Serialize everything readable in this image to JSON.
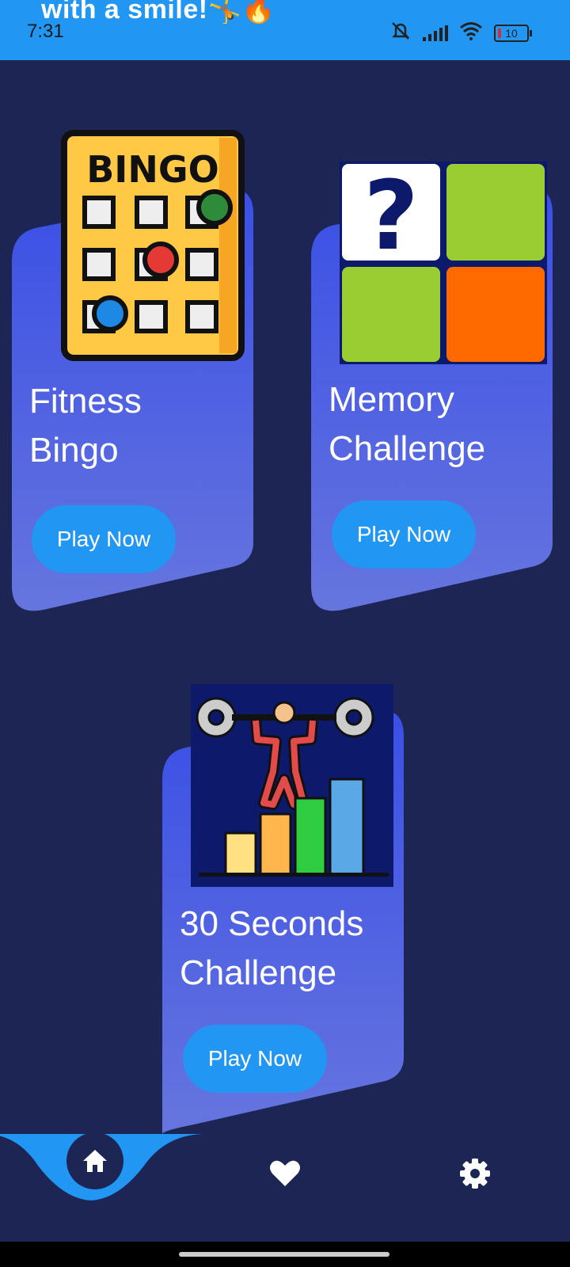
{
  "status_bar": {
    "banner_text": "with a smile!🤸🔥",
    "time": "7:31",
    "battery_level": "10",
    "icons": [
      "mute-icon",
      "signal-icon",
      "wifi-icon",
      "battery-icon"
    ]
  },
  "cards": [
    {
      "title": "Fitness\nBingo",
      "button_label": "Play Now",
      "image": "bingo-card-icon"
    },
    {
      "title": "Memory\nChallenge",
      "button_label": "Play Now",
      "image": "memory-tiles-icon"
    },
    {
      "title": "30 Seconds\nChallenge",
      "button_label": "Play Now",
      "image": "weightlifter-chart-icon"
    }
  ],
  "bottom_nav": {
    "items": [
      "home-icon",
      "heart-icon",
      "settings-icon"
    ],
    "active": "home"
  },
  "colors": {
    "background": "#1c2554",
    "accent": "#2196f3",
    "card_gradient_top": "#3a4fe6",
    "card_gradient_bottom": "#6675de"
  }
}
